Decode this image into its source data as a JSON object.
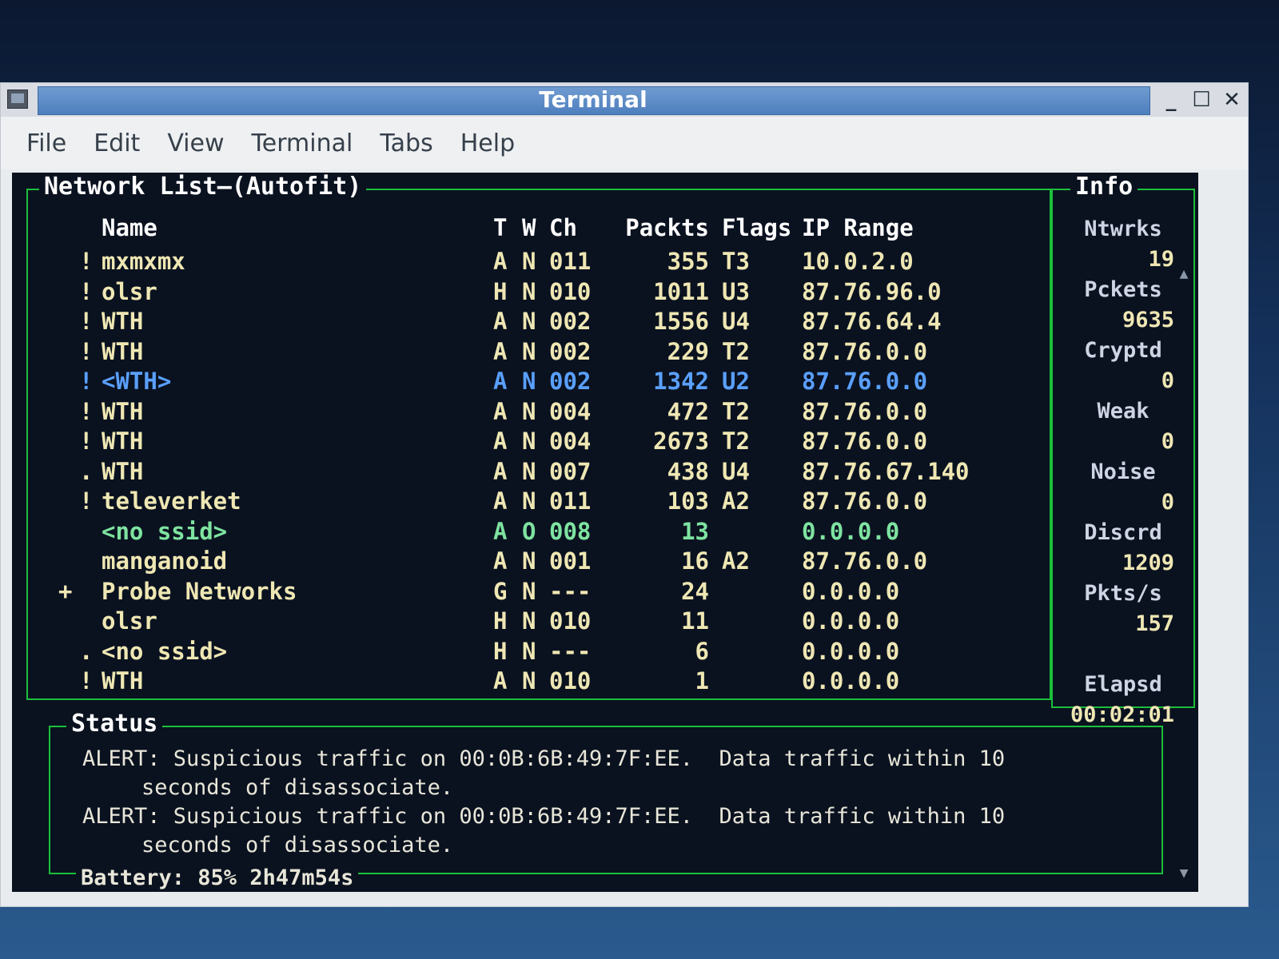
{
  "window": {
    "title": "Terminal",
    "controls": {
      "minimize": "_",
      "maximize": "☐",
      "close": "✕"
    },
    "menu": [
      "File",
      "Edit",
      "View",
      "Terminal",
      "Tabs",
      "Help"
    ]
  },
  "network_list": {
    "title": "Network List—(Autofit)",
    "headers": {
      "name": "Name",
      "t": "T",
      "w": "W",
      "ch": "Ch",
      "packets": "Packts",
      "flags": "Flags",
      "ip": "IP Range"
    },
    "rows": [
      {
        "mark": "!",
        "name": "mxmxmx",
        "t": "A",
        "w": "N",
        "ch": "011",
        "packets": "355",
        "flags": "T3",
        "ip": "10.0.2.0"
      },
      {
        "mark": "!",
        "name": "olsr",
        "t": "H",
        "w": "N",
        "ch": "010",
        "packets": "1011",
        "flags": "U3",
        "ip": "87.76.96.0"
      },
      {
        "mark": "!",
        "name": "WTH",
        "t": "A",
        "w": "N",
        "ch": "002",
        "packets": "1556",
        "flags": "U4",
        "ip": "87.76.64.4"
      },
      {
        "mark": "!",
        "name": "WTH",
        "t": "A",
        "w": "N",
        "ch": "002",
        "packets": "229",
        "flags": "T2",
        "ip": "87.76.0.0"
      },
      {
        "mark": "!",
        "name": "<WTH>",
        "t": "A",
        "w": "N",
        "ch": "002",
        "packets": "1342",
        "flags": "U2",
        "ip": "87.76.0.0"
      },
      {
        "mark": "!",
        "name": "WTH",
        "t": "A",
        "w": "N",
        "ch": "004",
        "packets": "472",
        "flags": "T2",
        "ip": "87.76.0.0"
      },
      {
        "mark": "!",
        "name": "WTH",
        "t": "A",
        "w": "N",
        "ch": "004",
        "packets": "2673",
        "flags": "T2",
        "ip": "87.76.0.0"
      },
      {
        "mark": ".",
        "name": "WTH",
        "t": "A",
        "w": "N",
        "ch": "007",
        "packets": "438",
        "flags": "U4",
        "ip": "87.76.67.140"
      },
      {
        "mark": "!",
        "name": "televerket",
        "t": "A",
        "w": "N",
        "ch": "011",
        "packets": "103",
        "flags": "A2",
        "ip": "87.76.0.0"
      },
      {
        "mark": "",
        "name": "<no ssid>",
        "t": "A",
        "w": "O",
        "ch": "008",
        "packets": "13",
        "flags": "",
        "ip": "0.0.0.0"
      },
      {
        "mark": "",
        "name": "manganoid",
        "t": "A",
        "w": "N",
        "ch": "001",
        "packets": "16",
        "flags": "A2",
        "ip": "87.76.0.0"
      },
      {
        "mark": "+",
        "name": "Probe Networks",
        "t": "G",
        "w": "N",
        "ch": "---",
        "packets": "24",
        "flags": "",
        "ip": "0.0.0.0"
      },
      {
        "mark": "",
        "name": "olsr",
        "t": "H",
        "w": "N",
        "ch": "010",
        "packets": "11",
        "flags": "",
        "ip": "0.0.0.0"
      },
      {
        "mark": ".",
        "name": "<no ssid>",
        "t": "H",
        "w": "N",
        "ch": "---",
        "packets": "6",
        "flags": "",
        "ip": "0.0.0.0"
      },
      {
        "mark": "!",
        "name": "WTH",
        "t": "A",
        "w": "N",
        "ch": "010",
        "packets": "1",
        "flags": "",
        "ip": "0.0.0.0"
      }
    ],
    "selected_index": 4,
    "green_index": 9,
    "plus_index": 11
  },
  "info": {
    "title": "Info",
    "items": [
      {
        "label": "Ntwrks",
        "value": "19"
      },
      {
        "label": "Pckets",
        "value": "9635"
      },
      {
        "label": "Cryptd",
        "value": "0"
      },
      {
        "label": "Weak",
        "value": "0"
      },
      {
        "label": "Noise",
        "value": "0"
      },
      {
        "label": "Discrd",
        "value": "1209"
      },
      {
        "label": "Pkts/s",
        "value": "157"
      }
    ],
    "elapsed_label": "Elapsd",
    "elapsed_value": "00:02:01"
  },
  "status": {
    "title": "Status",
    "lines": [
      "ALERT: Suspicious traffic on 00:0B:6B:49:7F:EE.  Data traffic within 10",
      "seconds of disassociate.",
      "ALERT: Suspicious traffic on 00:0B:6B:49:7F:EE.  Data traffic within 10",
      "seconds of disassociate."
    ],
    "battery": "Battery: 85% 2h47m54s"
  },
  "colors": {
    "terminal_bg": "#0a1220",
    "border_green": "#1bbf3a",
    "text_yellow": "#efe7b3",
    "selected_blue": "#5aa0ff",
    "green_row": "#7ee3a0"
  }
}
